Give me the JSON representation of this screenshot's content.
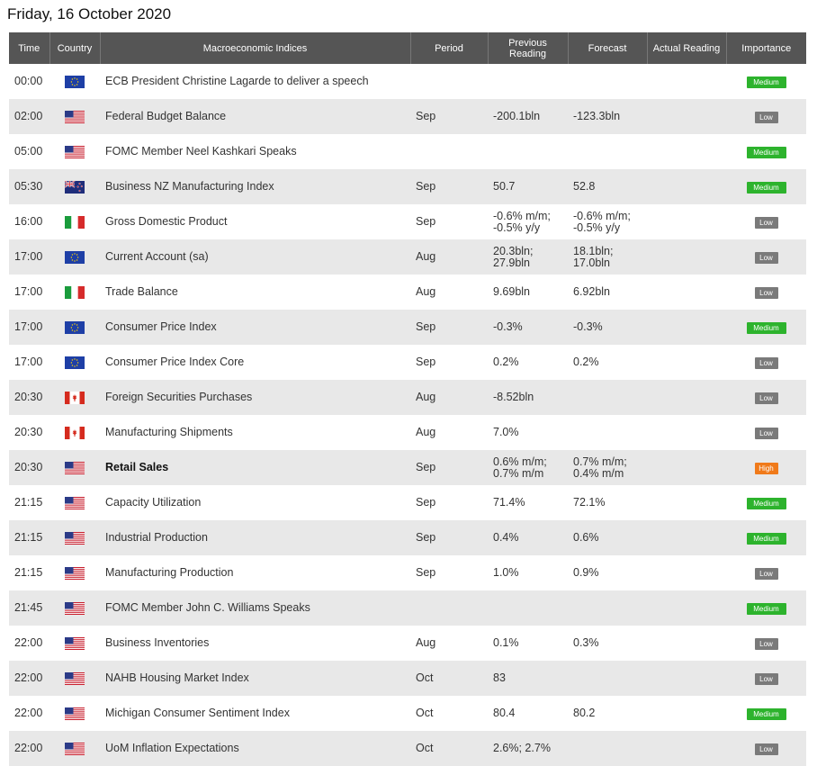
{
  "page": {
    "date_title": "Friday, 16 October 2020"
  },
  "headers": {
    "time": "Time",
    "country": "Country",
    "indices": "Macroeconomic Indices",
    "period": "Period",
    "previous_1": "Previous",
    "previous_2": "Reading",
    "forecast": "Forecast",
    "actual": "Actual Reading",
    "importance": "Importance"
  },
  "colors": {
    "header_bg": "#555555",
    "row_alt_bg": "#e8e8e8",
    "medium": "#2db32d",
    "low": "#7a7a7a",
    "high": "#f07a1a"
  },
  "rows": [
    {
      "time": "00:00",
      "flag": "eu-flag-icon",
      "event": "ECB President Christine Lagarde to deliver a speech",
      "period": "",
      "prev1": "",
      "prev2": "",
      "fc1": "",
      "fc2": "",
      "actual": "",
      "importance": "Medium",
      "level": "medium",
      "bold": false
    },
    {
      "time": "02:00",
      "flag": "us-flag-icon",
      "event": "Federal Budget Balance",
      "period": "Sep",
      "prev1": "-200.1bln",
      "prev2": "",
      "fc1": "-123.3bln",
      "fc2": "",
      "actual": "",
      "importance": "Low",
      "level": "low",
      "bold": false
    },
    {
      "time": "05:00",
      "flag": "us-flag-icon",
      "event": "FOMC Member Neel Kashkari Speaks",
      "period": "",
      "prev1": "",
      "prev2": "",
      "fc1": "",
      "fc2": "",
      "actual": "",
      "importance": "Medium",
      "level": "medium",
      "bold": false
    },
    {
      "time": "05:30",
      "flag": "nz-flag-icon",
      "event": "Business NZ Manufacturing Index",
      "period": "Sep",
      "prev1": "50.7",
      "prev2": "",
      "fc1": "52.8",
      "fc2": "",
      "actual": "",
      "importance": "Medium",
      "level": "medium",
      "bold": false
    },
    {
      "time": "16:00",
      "flag": "it-flag-icon",
      "event": "Gross Domestic Product",
      "period": "Sep",
      "prev1": "-0.6% m/m;",
      "prev2": "-0.5% y/y",
      "fc1": "-0.6% m/m;",
      "fc2": "-0.5% y/y",
      "actual": "",
      "importance": "Low",
      "level": "low",
      "bold": false
    },
    {
      "time": "17:00",
      "flag": "eu-flag-icon",
      "event": "Current Account (sa)",
      "period": "Aug",
      "prev1": "20.3bln;",
      "prev2": "27.9bln",
      "fc1": "18.1bln;",
      "fc2": "17.0bln",
      "actual": "",
      "importance": "Low",
      "level": "low",
      "bold": false
    },
    {
      "time": "17:00",
      "flag": "it-flag-icon",
      "event": "Trade Balance",
      "period": "Aug",
      "prev1": "9.69bln",
      "prev2": "",
      "fc1": "6.92bln",
      "fc2": "",
      "actual": "",
      "importance": "Low",
      "level": "low",
      "bold": false
    },
    {
      "time": "17:00",
      "flag": "eu-flag-icon",
      "event": "Consumer Price Index",
      "period": "Sep",
      "prev1": "-0.3%",
      "prev2": "",
      "fc1": "-0.3%",
      "fc2": "",
      "actual": "",
      "importance": "Medium",
      "level": "medium",
      "bold": false
    },
    {
      "time": "17:00",
      "flag": "eu-flag-icon",
      "event": "Consumer Price Index Core",
      "period": "Sep",
      "prev1": "0.2%",
      "prev2": "",
      "fc1": "0.2%",
      "fc2": "",
      "actual": "",
      "importance": "Low",
      "level": "low",
      "bold": false
    },
    {
      "time": "20:30",
      "flag": "ca-flag-icon",
      "event": "Foreign Securities Purchases",
      "period": "Aug",
      "prev1": "-8.52bln",
      "prev2": "",
      "fc1": "",
      "fc2": "",
      "actual": "",
      "importance": "Low",
      "level": "low",
      "bold": false
    },
    {
      "time": "20:30",
      "flag": "ca-flag-icon",
      "event": "Manufacturing Shipments",
      "period": "Aug",
      "prev1": "7.0%",
      "prev2": "",
      "fc1": "",
      "fc2": "",
      "actual": "",
      "importance": "Low",
      "level": "low",
      "bold": false
    },
    {
      "time": "20:30",
      "flag": "us-flag-icon",
      "event": "Retail Sales",
      "period": "Sep",
      "prev1": "0.6% m/m;",
      "prev2": "0.7% m/m",
      "fc1": "0.7% m/m;",
      "fc2": "0.4% m/m",
      "actual": "",
      "importance": "High",
      "level": "high",
      "bold": true
    },
    {
      "time": "21:15",
      "flag": "us-flag-icon",
      "event": "Capacity Utilization",
      "period": "Sep",
      "prev1": "71.4%",
      "prev2": "",
      "fc1": "72.1%",
      "fc2": "",
      "actual": "",
      "importance": "Medium",
      "level": "medium",
      "bold": false
    },
    {
      "time": "21:15",
      "flag": "us-flag-icon",
      "event": "Industrial Production",
      "period": "Sep",
      "prev1": "0.4%",
      "prev2": "",
      "fc1": "0.6%",
      "fc2": "",
      "actual": "",
      "importance": "Medium",
      "level": "medium",
      "bold": false
    },
    {
      "time": "21:15",
      "flag": "us-flag-icon",
      "event": "Manufacturing Production",
      "period": "Sep",
      "prev1": "1.0%",
      "prev2": "",
      "fc1": "0.9%",
      "fc2": "",
      "actual": "",
      "importance": "Low",
      "level": "low",
      "bold": false
    },
    {
      "time": "21:45",
      "flag": "us-flag-icon",
      "event": "FOMC Member John C. Williams Speaks",
      "period": "",
      "prev1": "",
      "prev2": "",
      "fc1": "",
      "fc2": "",
      "actual": "",
      "importance": "Medium",
      "level": "medium",
      "bold": false
    },
    {
      "time": "22:00",
      "flag": "us-flag-icon",
      "event": "Business Inventories",
      "period": "Aug",
      "prev1": "0.1%",
      "prev2": "",
      "fc1": "0.3%",
      "fc2": "",
      "actual": "",
      "importance": "Low",
      "level": "low",
      "bold": false
    },
    {
      "time": "22:00",
      "flag": "us-flag-icon",
      "event": "NAHB Housing Market Index",
      "period": "Oct",
      "prev1": "83",
      "prev2": "",
      "fc1": "",
      "fc2": "",
      "actual": "",
      "importance": "Low",
      "level": "low",
      "bold": false
    },
    {
      "time": "22:00",
      "flag": "us-flag-icon",
      "event": "Michigan Consumer Sentiment Index",
      "period": "Oct",
      "prev1": "80.4",
      "prev2": "",
      "fc1": "80.2",
      "fc2": "",
      "actual": "",
      "importance": "Medium",
      "level": "medium",
      "bold": false
    },
    {
      "time": "22:00",
      "flag": "us-flag-icon",
      "event": "UoM Inflation Expectations",
      "period": "Oct",
      "prev1": "2.6%; 2.7%",
      "prev2": "",
      "fc1": "",
      "fc2": "",
      "actual": "",
      "importance": "Low",
      "level": "low",
      "bold": false
    }
  ]
}
